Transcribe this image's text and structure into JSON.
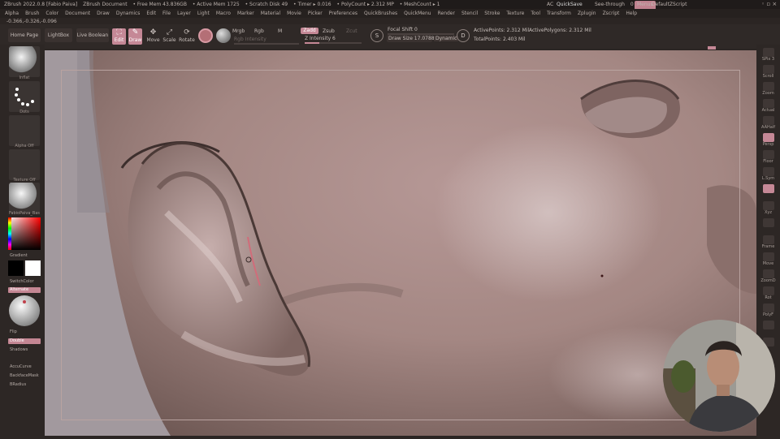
{
  "titlebar": {
    "app": "ZBrush 2022.0.8 [Fabio Paiva]",
    "document": "ZBrush Document",
    "free_mem": "• Free Mem 43.836GB",
    "active_mem": "• Active Mem 1725",
    "scratch": "• Scratch Disk 49",
    "timer": "• Timer ▸ 0.016",
    "polycount": "• PolyCount ▸ 2.312 MP",
    "meshcount": "• MeshCount ▸ 1",
    "ac": "AC",
    "quicksave": "QuickSave",
    "see_through": "See-through",
    "see_through_val": "0",
    "menus": "Menus",
    "script": "DefaultZScript"
  },
  "menubar": [
    "Alpha",
    "Brush",
    "Color",
    "Document",
    "Draw",
    "Dynamics",
    "Edit",
    "File",
    "Layer",
    "Light",
    "Macro",
    "Marker",
    "Material",
    "Movie",
    "Picker",
    "Preferences",
    "QuickBrushes",
    "QuickMenu",
    "Render",
    "Stencil",
    "Stroke",
    "Texture",
    "Tool",
    "Transform",
    "Zplugin",
    "Zscript",
    "Help"
  ],
  "coords": "-0.366,-0.326,-0.096",
  "toolbar": {
    "home": "Home Page",
    "lightbox": "LightBox",
    "live_boolean": "Live Boolean",
    "edit": "Edit",
    "draw": "Draw",
    "move": "Move",
    "scale": "Scale",
    "rotate": "Rotate",
    "mrgb": "Mrgb",
    "rgb": "Rgb",
    "m": "M",
    "rgb_intensity": "Rgb Intensity",
    "zadd": "Zadd",
    "zsub": "Zsub",
    "zcut": "Zcut",
    "z_intensity": "Z Intensity 6",
    "focal_shift": "Focal Shift 0",
    "draw_size": "Draw Size 17.0788",
    "dynamic": "Dynamic",
    "active_points": "ActivePoints: 2.312 Mil",
    "total_points": "TotalPoints: 2.403 Mil",
    "active_polygons": "ActivePolygons: 2.312 Mil"
  },
  "left": {
    "brush": "Inflat",
    "stroke": "Dots",
    "alpha": "Alpha Off",
    "texture": "Texture Off",
    "material": "FabioPaiva_Bas",
    "gradient": "Gradient",
    "switchcolor": "SwitchColor",
    "alternate": "Alternate",
    "flip": "Flip",
    "double": "Double",
    "shadows": "Shadows",
    "accucurve": "AccuCurve",
    "backfacemask": "BackfaceMask",
    "bradius": "BRadius"
  },
  "right": [
    "SPix 3",
    "Scroll",
    "Zoom",
    "Actual",
    "AAHalf",
    "Persp",
    "Floor",
    "L.Sym",
    "",
    "Xyz",
    "",
    "Frame",
    "Move",
    "ZoomD",
    "Rot",
    "PolyF",
    "",
    ""
  ],
  "colors": {
    "accent": "#c58896"
  }
}
